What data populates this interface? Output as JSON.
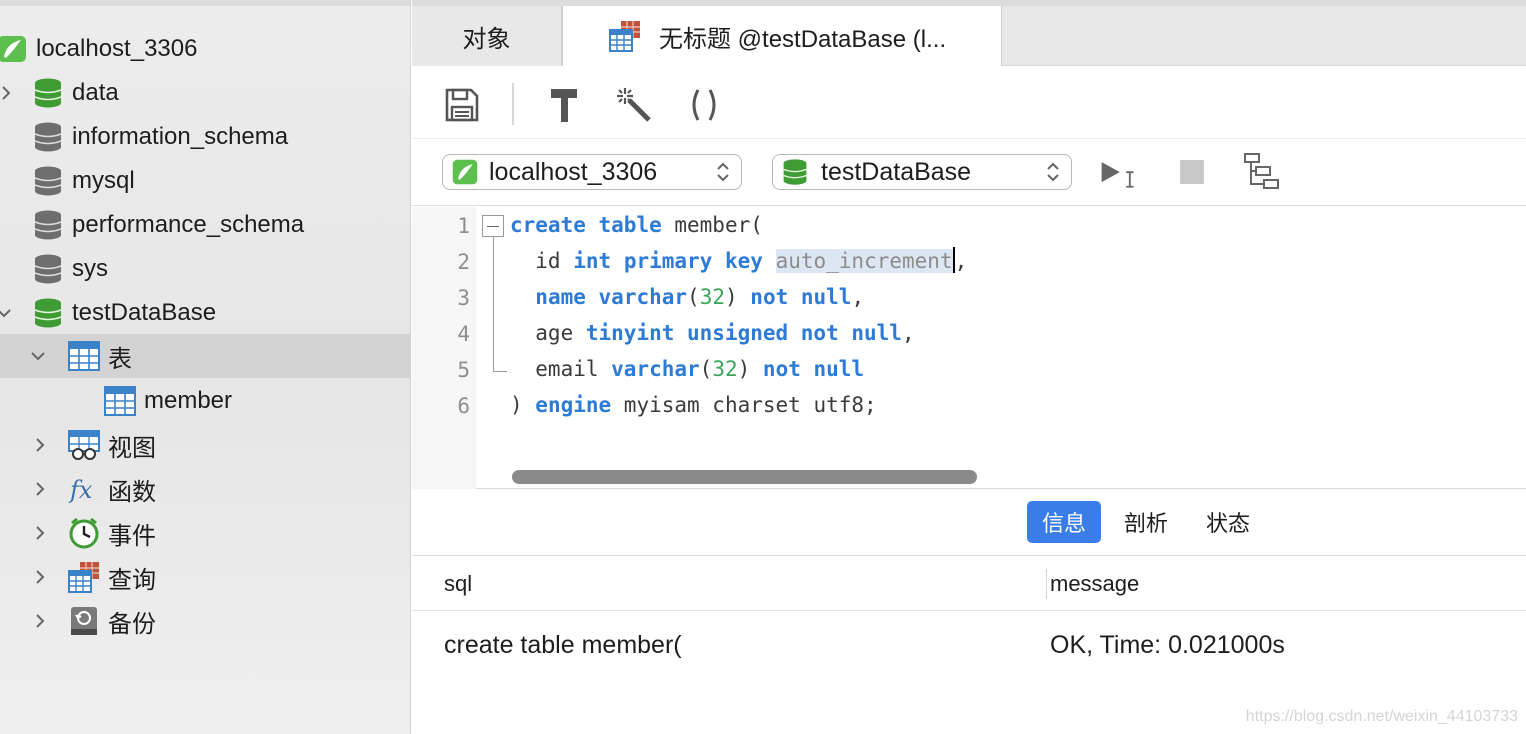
{
  "sidebar": {
    "connection": {
      "label": "localhost_3306",
      "icon": "connection-icon"
    },
    "databases": [
      {
        "label": "data",
        "icon": "database-green-icon",
        "expanded": false
      },
      {
        "label": "information_schema",
        "icon": "database-gray-icon"
      },
      {
        "label": "mysql",
        "icon": "database-gray-icon"
      },
      {
        "label": "performance_schema",
        "icon": "database-gray-icon"
      },
      {
        "label": "sys",
        "icon": "database-gray-icon"
      },
      {
        "label": "testDataBase",
        "icon": "database-green-icon",
        "expanded": true
      }
    ],
    "groups": [
      {
        "label": "表",
        "icon": "table-icon",
        "expanded": true,
        "selected": true
      },
      {
        "label": "member",
        "icon": "table-icon"
      },
      {
        "label": "视图",
        "icon": "view-icon"
      },
      {
        "label": "函数",
        "icon": "function-icon"
      },
      {
        "label": "事件",
        "icon": "event-clock-icon"
      },
      {
        "label": "查询",
        "icon": "query-icon"
      },
      {
        "label": "备份",
        "icon": "backup-icon"
      }
    ]
  },
  "tabs": {
    "objects": "对象",
    "query": "无标题 @testDataBase (l..."
  },
  "toolbar": {
    "icons": [
      "save-icon",
      "beautify-hammer-icon",
      "magic-wand-icon",
      "parentheses-icon"
    ]
  },
  "selectors": {
    "connection": "localhost_3306",
    "database": "testDataBase"
  },
  "editor": {
    "line_numbers": [
      "1",
      "2",
      "3",
      "4",
      "5",
      "6"
    ],
    "lines": [
      {
        "p1": "create",
        "p2": " ",
        "p3": "table",
        "p4": " member("
      },
      {
        "p1": "  id ",
        "p2": "int",
        "p3": " ",
        "p4": "primary",
        "p5": " ",
        "p6": "key",
        "p7": " ",
        "p8": "auto_increment",
        "p9": ","
      },
      {
        "p1": "  ",
        "p2": "name",
        "p3": " ",
        "p4": "varchar",
        "p5": "(",
        "p6": "32",
        "p7": ") ",
        "p8": "not null",
        "p9": ","
      },
      {
        "p1": "  age ",
        "p2": "tinyint unsigned not null",
        "p3": ","
      },
      {
        "p1": "  email ",
        "p2": "varchar",
        "p3": "(",
        "p4": "32",
        "p5": ") ",
        "p6": "not null"
      },
      {
        "p1": ") ",
        "p2": "engine",
        "p3": " myisam charset utf8;"
      }
    ]
  },
  "result_tabs": [
    "信息",
    "剖析",
    "状态"
  ],
  "result": {
    "columns": [
      "sql",
      "message"
    ],
    "rows": [
      {
        "sql": "create table member(",
        "message": "OK, Time: 0.021000s"
      }
    ]
  },
  "watermark": "https://blog.csdn.net/weixin_44103733",
  "colors": {
    "accent": "#3a7de8",
    "keyword": "#2e7bd6",
    "number": "#3aa55a",
    "db_green": "#3f9c35"
  }
}
